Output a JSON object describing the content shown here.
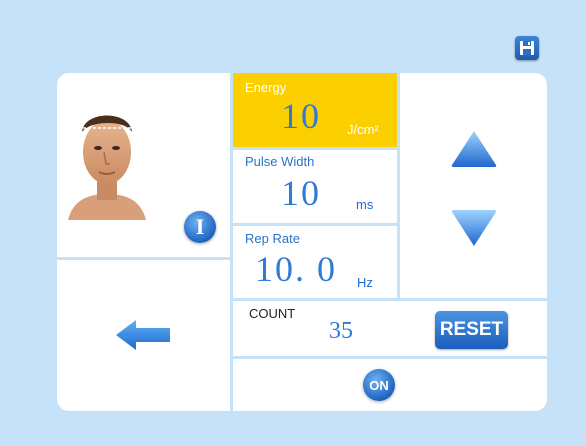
{
  "toolbar": {
    "save_icon": "save-icon"
  },
  "energy": {
    "label": "Energy",
    "value": "10",
    "unit": "J/cm²"
  },
  "pulse_width": {
    "label": "Pulse Width",
    "value": "10",
    "unit": "ms"
  },
  "rep_rate": {
    "label": "Rep Rate",
    "value": "10. 0",
    "unit": "Hz"
  },
  "count": {
    "label": "COUNT",
    "value": "35"
  },
  "buttons": {
    "info": "I",
    "reset": "RESET",
    "on": "ON"
  },
  "icons": {
    "up": "triangle-up-icon",
    "down": "triangle-down-icon",
    "back": "back-arrow-icon"
  },
  "colors": {
    "background": "#c6e2f8",
    "highlight": "#fcd000",
    "accent": "#2e7bd6"
  }
}
